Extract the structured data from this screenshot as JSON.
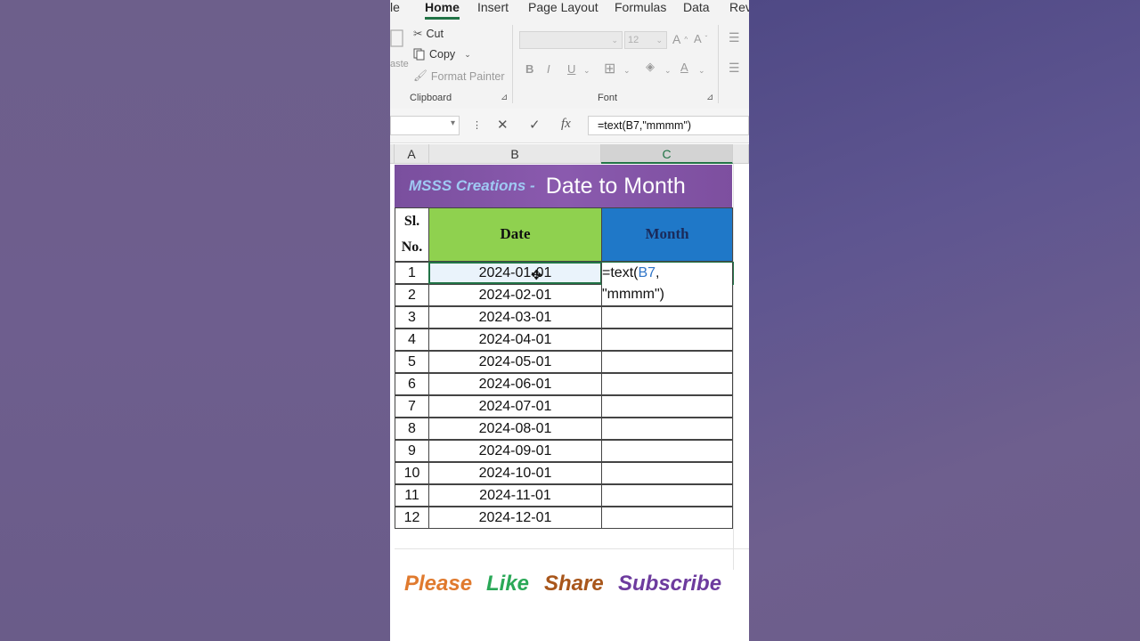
{
  "ribbon": {
    "tabs": [
      "le",
      "Home",
      "Insert",
      "Page Layout",
      "Formulas",
      "Data",
      "Rev"
    ],
    "active_tab": "Home",
    "clipboard": {
      "paste_partial": "aste",
      "cut": "Cut",
      "copy": "Copy",
      "format_painter": "Format Painter",
      "group_label": "Clipboard"
    },
    "font": {
      "size": "12",
      "bold": "B",
      "italic": "I",
      "underline": "U",
      "group_label": "Font"
    }
  },
  "formula_bar": {
    "cancel_icon": "close-icon",
    "enter_icon": "check-icon",
    "fx_label": "fx",
    "formula": "=text(B7,\"mmmm\")"
  },
  "columns": [
    "A",
    "B",
    "C"
  ],
  "banner": {
    "brand": "MSSS Creations -",
    "title": "Date to Month"
  },
  "table": {
    "header_sl_line1": "Sl.",
    "header_sl_line2": "No.",
    "header_date": "Date",
    "header_month": "Month",
    "rows": [
      {
        "sl": "1",
        "date": "2024-01-01"
      },
      {
        "sl": "2",
        "date": "2024-02-01"
      },
      {
        "sl": "3",
        "date": "2024-03-01"
      },
      {
        "sl": "4",
        "date": "2024-04-01"
      },
      {
        "sl": "5",
        "date": "2024-05-01"
      },
      {
        "sl": "6",
        "date": "2024-06-01"
      },
      {
        "sl": "7",
        "date": "2024-07-01"
      },
      {
        "sl": "8",
        "date": "2024-08-01"
      },
      {
        "sl": "9",
        "date": "2024-09-01"
      },
      {
        "sl": "10",
        "date": "2024-10-01"
      },
      {
        "sl": "11",
        "date": "2024-11-01"
      },
      {
        "sl": "12",
        "date": "2024-12-01"
      }
    ],
    "editing_formula_part1": "=text(",
    "editing_formula_ref": "B7",
    "editing_formula_part2": ",",
    "editing_formula_line2": "\"mmmm\")"
  },
  "footer": {
    "please": "Please",
    "like": "Like",
    "share": "Share",
    "subscribe": "Subscribe"
  },
  "colors": {
    "accent": "#217346",
    "banner": "#7a4f9e",
    "date_header": "#8fd14f",
    "month_header": "#1f78c8"
  }
}
